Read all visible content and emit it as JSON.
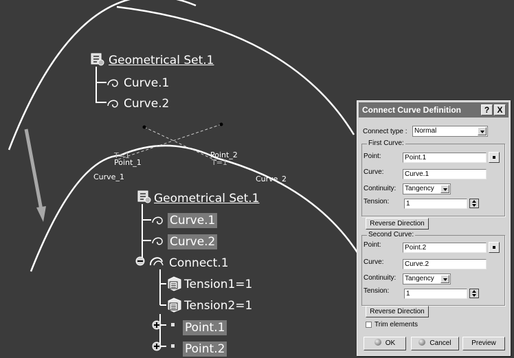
{
  "tree_top": {
    "root": "Geometrical Set.1",
    "items": [
      "Curve.1",
      "Curve.2"
    ]
  },
  "tree_bottom": {
    "root": "Geometrical Set.1",
    "items": [
      "Curve.1",
      "Curve.2",
      "Connect.1",
      "Tension1=1",
      "Tension2=1",
      "Point.1",
      "Point.2"
    ]
  },
  "labels": {
    "point_1": "Point_1",
    "point_2": "Point_2",
    "t1": "T=1",
    "t1b": "T=1",
    "curve_1": "Curve_1",
    "curve_2": "Curve_2"
  },
  "dialog": {
    "title": "Connect Curve Definition",
    "help": "?",
    "close": "X",
    "connect_type_label": "Connect type :",
    "connect_type_value": "Normal",
    "first_curve": {
      "group": "First Curve:",
      "point_label": "Point:",
      "point_value": "Point.1",
      "curve_label": "Curve:",
      "curve_value": "Curve.1",
      "continuity_label": "Continuity:",
      "continuity_value": "Tangency",
      "tension_label": "Tension:",
      "tension_value": "1"
    },
    "reverse_1": "Reverse Direction",
    "second_curve": {
      "group": "Second Curve:",
      "point_label": "Point:",
      "point_value": "Point.2",
      "curve_label": "Curve:",
      "curve_value": "Curve.2",
      "continuity_label": "Continuity:",
      "continuity_value": "Tangency",
      "tension_label": "Tension:",
      "tension_value": "1"
    },
    "reverse_2": "Reverse Direction",
    "trim_label": "Trim elements",
    "ok": "OK",
    "cancel": "Cancel",
    "preview": "Preview"
  },
  "colors": {
    "background": "#3b3b3b",
    "highlight": "#7a7a7a",
    "dialog": "#d4d4d4",
    "title_bar": "#6f6f6f"
  }
}
